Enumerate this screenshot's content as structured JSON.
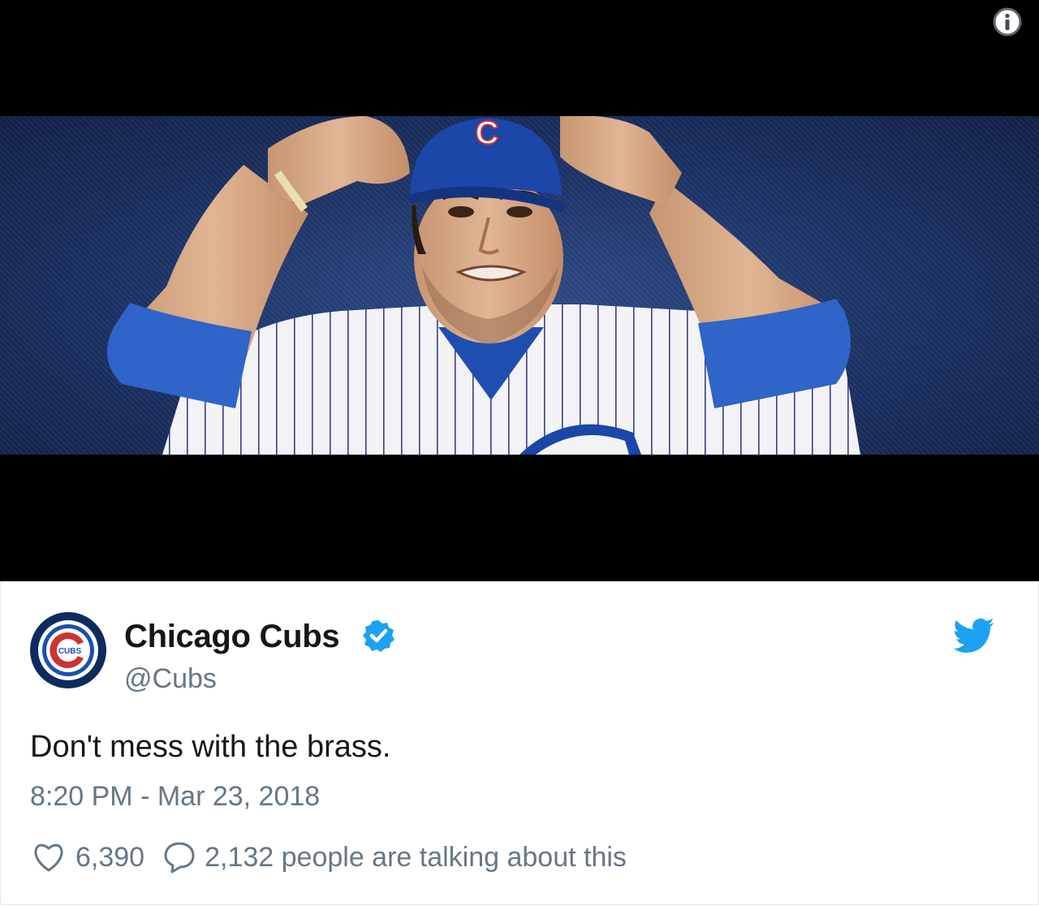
{
  "media": {
    "info_icon": "info-icon",
    "cap_letter": "C",
    "scene": "player in pinstripe jersey adjusting cap"
  },
  "tweet": {
    "author": {
      "display_name": "Chicago Cubs",
      "handle": "@Cubs",
      "avatar_icon": "cubs-logo",
      "avatar_text": "CUBS",
      "verified_icon": "verified-badge-icon"
    },
    "brand_icon": "twitter-bird-icon",
    "text": "Don't mess with the brass.",
    "timestamp": "8:20 PM - Mar 23, 2018",
    "likes": "6,390",
    "talking": "2,132 people are talking about this"
  },
  "colors": {
    "twitter_blue": "#1da1f2",
    "cubs_blue": "#0e3386",
    "cubs_red": "#cc3433",
    "muted_text": "#657786",
    "primary_text": "#14171a"
  }
}
